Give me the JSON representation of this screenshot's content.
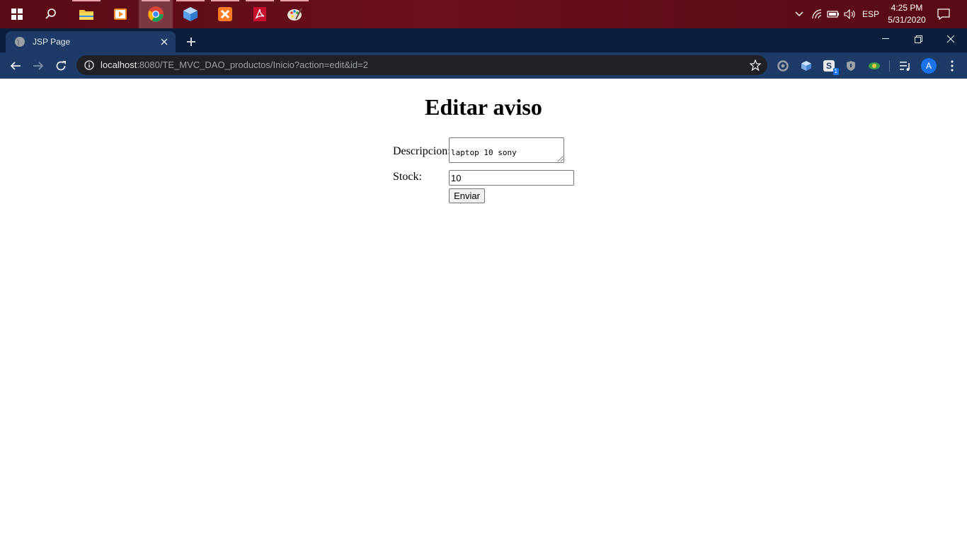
{
  "taskbar": {
    "apps": [
      {
        "name": "start",
        "icon": "windows-logo-icon"
      },
      {
        "name": "search",
        "icon": "search-icon"
      },
      {
        "name": "file-explorer",
        "icon": "folder-icon"
      },
      {
        "name": "media-player",
        "icon": "media-player-icon"
      },
      {
        "name": "chrome",
        "icon": "chrome-icon"
      },
      {
        "name": "virtualbox",
        "icon": "cube-icon"
      },
      {
        "name": "xampp",
        "icon": "xampp-icon"
      },
      {
        "name": "acrobat",
        "icon": "pdf-icon"
      },
      {
        "name": "paint",
        "icon": "palette-icon"
      }
    ],
    "tray": {
      "language": "ESP",
      "time": "4:25 PM",
      "date": "5/31/2020"
    }
  },
  "browser": {
    "tab_title": "JSP Page",
    "url_host": "localhost",
    "url_rest": ":8080/TE_MVC_DAO_productos/Inicio?action=edit&id=2",
    "profile_initial": "A",
    "extension_badge": "1"
  },
  "page": {
    "title": "Editar aviso",
    "description_label": "Descripcion:",
    "description_value": "laptop 10 sony",
    "stock_label": "Stock:",
    "stock_value": "10",
    "submit_label": "Enviar"
  },
  "colors": {
    "taskbar": "#5a0c16",
    "tabstrip": "#0b1f3d",
    "toolbar": "#1d3b66",
    "omnibox": "#202124",
    "accent": "#1a73e8"
  }
}
